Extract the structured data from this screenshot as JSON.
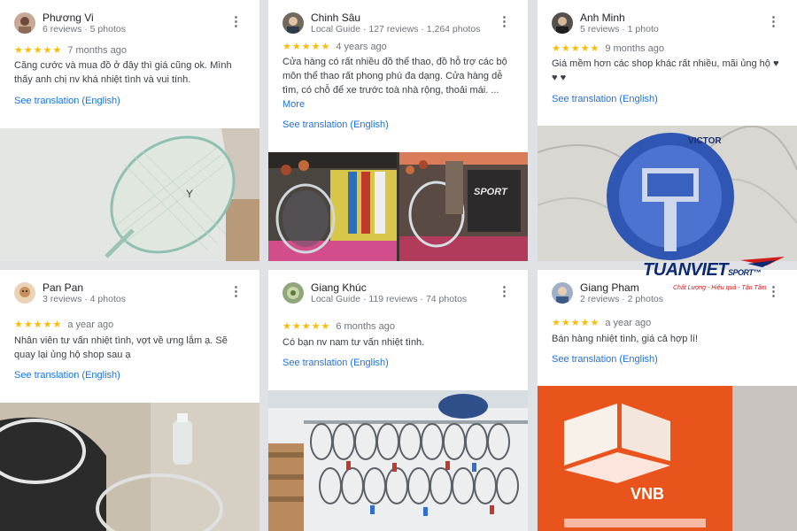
{
  "reviews": [
    {
      "name": "Phương Vi",
      "meta": "6 reviews · 5 photos",
      "stars": "★★★★★",
      "time": "7 months ago",
      "text": "Căng cước và mua đồ ở đây thì giá cũng ok. Mình thấy anh chị nv khá nhiệt tình và vui tính.",
      "more": "",
      "translate": "See translation (English)"
    },
    {
      "name": "Chinh Sâu",
      "meta": "Local Guide · 127 reviews · 1,264 photos",
      "stars": "★★★★★",
      "time": "4 years ago",
      "text": "Cửa hàng có rất nhiều đồ thể thao, đồ hỗ trợ các bộ môn thể thao rất phong phú đa dạng. Cửa hàng dễ tìm, có chỗ để xe trước toà nhà rộng, thoải mái. ...",
      "more": "More",
      "translate": "See translation (English)"
    },
    {
      "name": "Anh Minh",
      "meta": "5 reviews · 1 photo",
      "stars": "★★★★★",
      "time": "9 months ago",
      "text": "Giá mềm hơn các shop khác rất nhiều, mãi ủng hộ ♥ ♥ ♥",
      "more": "",
      "translate": "See translation (English)"
    },
    {
      "name": "Pan Pan",
      "meta": "3 reviews · 4 photos",
      "stars": "★★★★★",
      "time": "a year ago",
      "text": "Nhân viên tư vấn nhiệt tình, vợt về ưng lắm ạ. Sẽ quay lại ủng hộ shop sau ạ",
      "more": "",
      "translate": "See translation (English)"
    },
    {
      "name": "Giang Khúc",
      "meta": "Local Guide · 119 reviews · 74 photos",
      "stars": "★★★★★",
      "time": "6 months ago",
      "text": "Có bạn nv nam tư vấn nhiệt tình.",
      "more": "",
      "translate": "See translation (English)"
    },
    {
      "name": "Giang Pham",
      "meta": "2 reviews · 2 photos",
      "stars": "★★★★★",
      "time": "a year ago",
      "text": "Bán hàng nhiệt tình, giá cả hợp lí!",
      "more": "",
      "translate": "See translation (English)"
    }
  ],
  "logo": {
    "main": "TUANVIET",
    "sport": "SPORT™",
    "tagline": "Chất Lượng - Hiệu quả - Tận Tâm"
  },
  "photo_text": {
    "sport_sign": "SPORT",
    "vnb_sign": "VNB"
  },
  "icons": {
    "more": "more-vert-icon",
    "star": "star-icon",
    "heart": "heart-icon"
  },
  "colors": {
    "star": "#fbbc04",
    "link": "#1a73e8",
    "logo_blue": "#0b2a6f",
    "logo_red": "#d11a1a",
    "vnb_orange": "#e8541c"
  }
}
